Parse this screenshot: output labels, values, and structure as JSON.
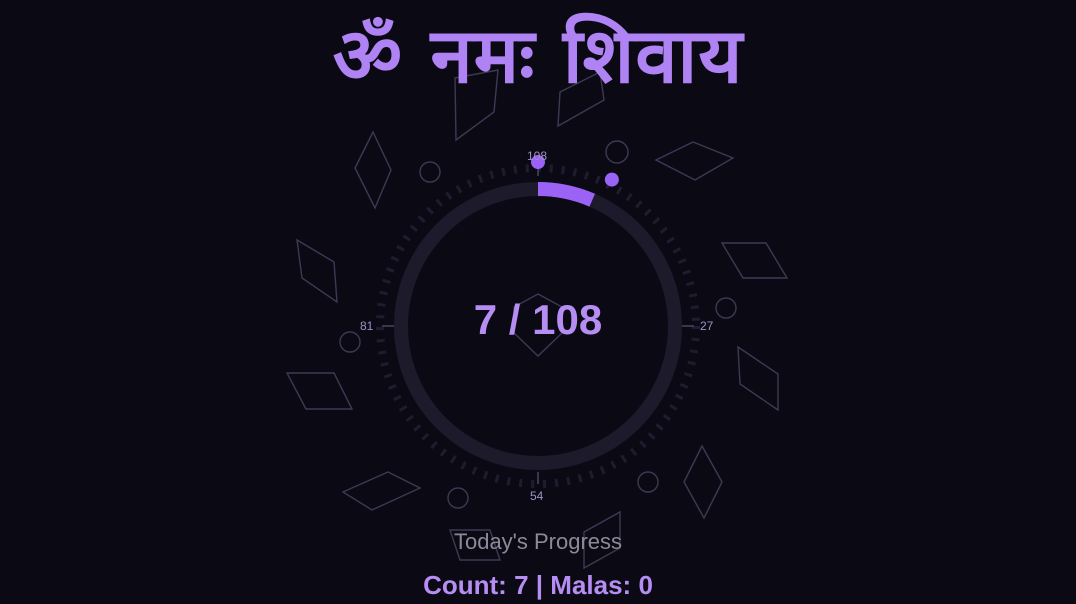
{
  "mantra": {
    "title": "ॐ नमः शिवाय"
  },
  "counter": {
    "current": "7",
    "separator": " / ",
    "target": "108",
    "progress_fraction": 0.0648
  },
  "dial": {
    "marks": {
      "top": "108",
      "right": "27",
      "bottom": "54",
      "left": "81"
    }
  },
  "progress": {
    "label": "Today's Progress",
    "count_label": "Count:",
    "count_value": "7",
    "divider": "|",
    "malas_label": "Malas:",
    "malas_value": "0"
  },
  "colors": {
    "accent": "#9a63f6",
    "text_accent": "#b68df3",
    "ring_track": "#1c1a2b",
    "background": "#0b0a14",
    "muted_text": "#8d8a98",
    "decor_stroke": "#3d3954"
  }
}
